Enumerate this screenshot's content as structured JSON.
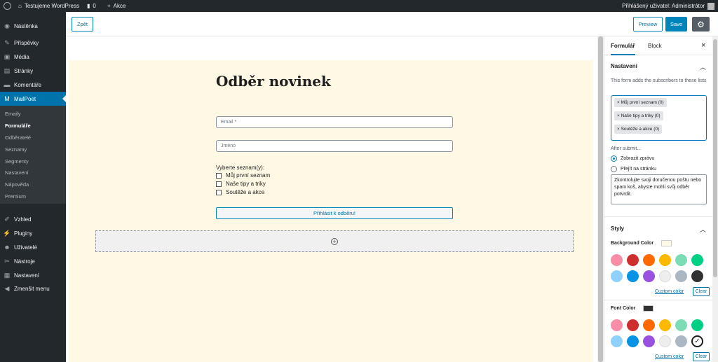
{
  "adminbar": {
    "site": "Testujeme WordPress",
    "comments": "0",
    "new": "Akce",
    "user": "Přihlášený uživatel: Administrátor"
  },
  "sidebar": {
    "items": [
      {
        "label": "Nástěnka",
        "icon": "dashboard-icon"
      },
      {
        "label": "Příspěvky",
        "icon": "pin-icon"
      },
      {
        "label": "Média",
        "icon": "media-icon"
      },
      {
        "label": "Stránky",
        "icon": "page-icon"
      },
      {
        "label": "Komentáře",
        "icon": "comment-icon"
      },
      {
        "label": "MailPoet",
        "icon": "mailpoet-icon"
      }
    ],
    "submenu": [
      "Emaily",
      "Formuláře",
      "Odběratelé",
      "Seznamy",
      "Segmenty",
      "Nastavení",
      "Nápověda",
      "Premium"
    ],
    "items2": [
      {
        "label": "Vzhled",
        "icon": "brush-icon"
      },
      {
        "label": "Pluginy",
        "icon": "plugin-icon"
      },
      {
        "label": "Uživatelé",
        "icon": "users-icon"
      },
      {
        "label": "Nástroje",
        "icon": "wrench-icon"
      },
      {
        "label": "Nastavení",
        "icon": "settings-icon"
      },
      {
        "label": "Zmenšit menu",
        "icon": "collapse-icon"
      }
    ]
  },
  "toolbar": {
    "back": "Zpět",
    "preview": "Preview",
    "save": "Save"
  },
  "form": {
    "title": "Odběr novinek",
    "email_placeholder": "Email *",
    "name_placeholder": "Jméno",
    "lists_label": "Vyberte seznam(y):",
    "lists": [
      "Můj první seznam",
      "Naše tipy a triky",
      "Soutěže a akce"
    ],
    "submit": "Přihlásit k odběru!"
  },
  "panel": {
    "tabs": [
      "Formulář",
      "Block"
    ],
    "close": "×",
    "settings_title": "Nastavení",
    "lists_help": "This form adds the subscribers to these lists",
    "tokens": [
      "× Můj první seznam (0)",
      "× Naše tipy a triky (0)",
      "× Soutěže a akce (0)"
    ],
    "after_submit": "After submit...",
    "radio1": "Zobrazit zprávu",
    "radio2": "Přejít na stránku",
    "message": "Zkontrolujte svoji doručenou poštu nebo spam koš, abyste mohli svůj odběr potvrdit.",
    "styles_title": "Styly",
    "bg_color_label": "Background Color",
    "font_color_label": "Font Color",
    "custom_color": "Custom color",
    "clear": "Clear",
    "bg_color_value": "#fff8e5",
    "font_color_value": "#313131",
    "palette": [
      "#f78da7",
      "#cf2e2e",
      "#ff6900",
      "#fcb900",
      "#7bdcb5",
      "#00d084",
      "#8ed1fc",
      "#0693e3",
      "#9b51e0",
      "#eeeeee",
      "#abb8c3",
      "#313131"
    ]
  }
}
